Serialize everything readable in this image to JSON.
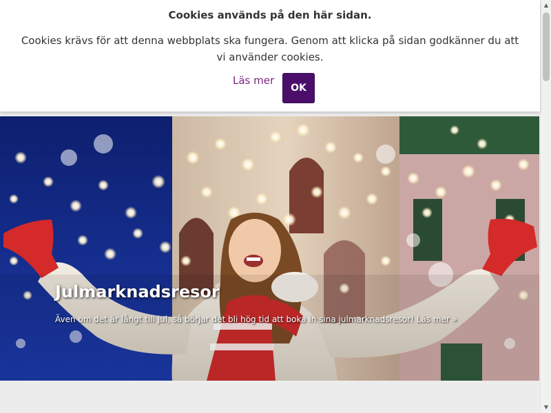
{
  "cookie_banner": {
    "title": "Cookies används på den här sidan.",
    "message": "Cookies krävs för att denna webbplats ska fungera. Genom att klicka på sidan godkänner du att vi använder cookies.",
    "read_more_label": "Läs mer",
    "ok_label": "OK"
  },
  "hero": {
    "title": "Julmarknadsresor",
    "teaser": "Även om det är långt till jul, så börjar det bli hög tid att boka in sina julmarknadsresor!",
    "read_more_label": "Läs mer »"
  },
  "scrollbar": {
    "up_icon": "▲",
    "down_icon": "▼"
  },
  "colors": {
    "accent": "#4b0f6b",
    "link": "#7a2380",
    "banner_bg": "#ffffff",
    "page_bg": "#ececec"
  }
}
